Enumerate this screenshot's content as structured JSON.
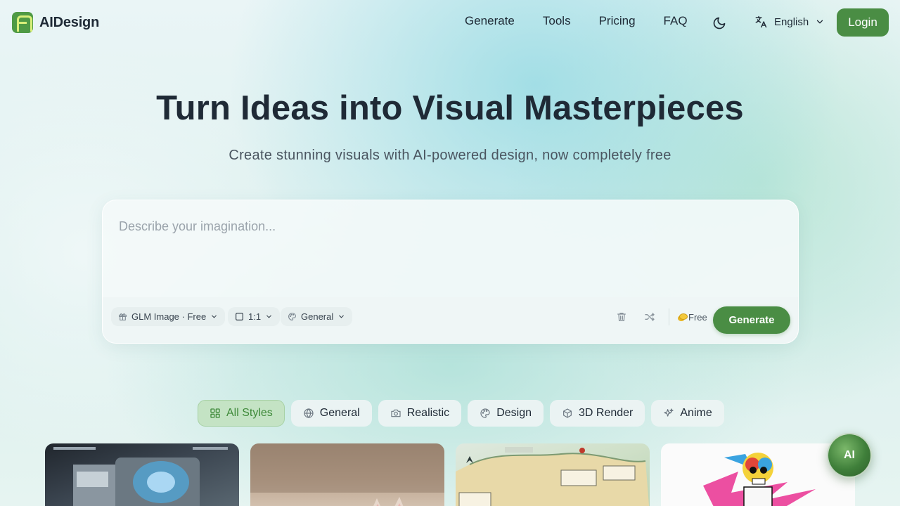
{
  "brand": {
    "name": "AIDesign",
    "accent": "#4a8d44"
  },
  "nav": {
    "links": [
      "Generate",
      "Tools",
      "Pricing",
      "FAQ"
    ],
    "theme_icon": "moon-icon",
    "language": "English",
    "login": "Login"
  },
  "hero": {
    "title": "Turn Ideas into Visual Masterpieces",
    "subtitle": "Create stunning visuals with AI-powered design, now completely free"
  },
  "prompt": {
    "placeholder": "Describe your imagination...",
    "model": "GLM Image · Free",
    "ratio": "1:1",
    "style": "General",
    "cost": "Free",
    "generate": "Generate"
  },
  "filters": [
    {
      "label": "All Styles",
      "icon": "grid-icon",
      "active": true
    },
    {
      "label": "General",
      "icon": "globe-icon",
      "active": false
    },
    {
      "label": "Realistic",
      "icon": "camera-icon",
      "active": false
    },
    {
      "label": "Design",
      "icon": "palette-icon",
      "active": false
    },
    {
      "label": "3D Render",
      "icon": "cube-icon",
      "active": false
    },
    {
      "label": "Anime",
      "icon": "sparkles-icon",
      "active": false
    }
  ],
  "gallery": [
    "sci-fi truck",
    "cat photo",
    "illustrated map",
    "skeleton pop art"
  ],
  "fab": {
    "label": "AI"
  }
}
